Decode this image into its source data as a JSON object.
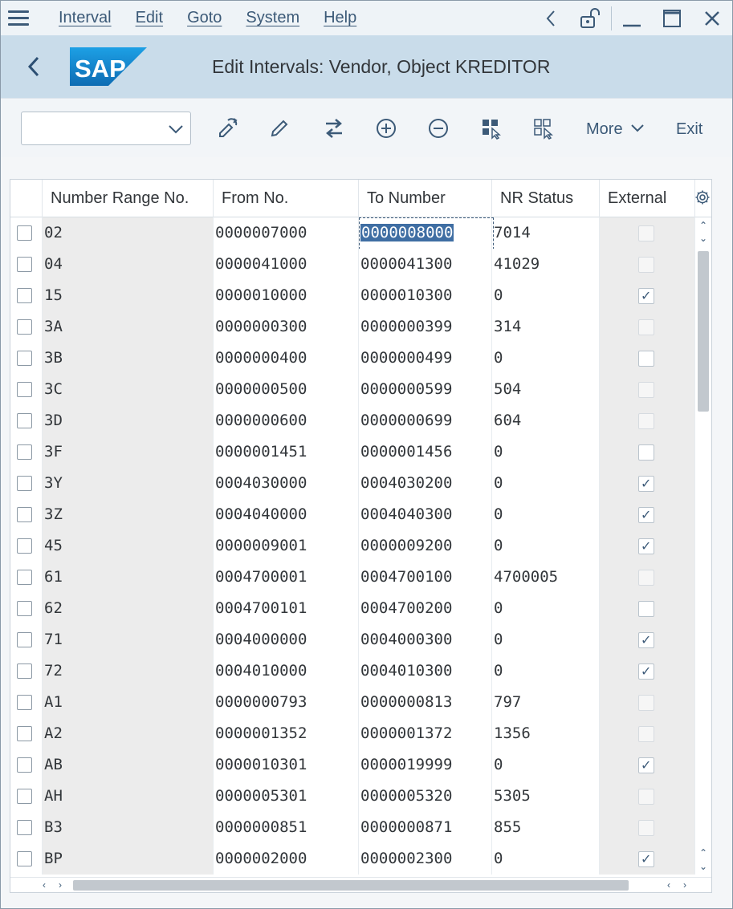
{
  "menu": {
    "items": [
      "Interval",
      "Edit",
      "Goto",
      "System",
      "Help"
    ]
  },
  "header": {
    "logo_text": "SAP",
    "title": "Edit Intervals: Vendor, Object KREDITOR"
  },
  "toolbar": {
    "combo_value": "",
    "more_label": "More",
    "exit_label": "Exit"
  },
  "table": {
    "columns": [
      "Number Range No.",
      "From No.",
      "To Number",
      "NR Status",
      "External"
    ],
    "rows": [
      {
        "nr": "02",
        "from": "0000007000",
        "to": "0000008000",
        "status": "7014",
        "external": false,
        "ext_disabled": true
      },
      {
        "nr": "04",
        "from": "0000041000",
        "to": "0000041300",
        "status": "41029",
        "external": false,
        "ext_disabled": true
      },
      {
        "nr": "15",
        "from": "0000010000",
        "to": "0000010300",
        "status": "0",
        "external": true,
        "ext_disabled": false
      },
      {
        "nr": "3A",
        "from": "0000000300",
        "to": "0000000399",
        "status": "314",
        "external": false,
        "ext_disabled": true
      },
      {
        "nr": "3B",
        "from": "0000000400",
        "to": "0000000499",
        "status": "0",
        "external": false,
        "ext_disabled": false
      },
      {
        "nr": "3C",
        "from": "0000000500",
        "to": "0000000599",
        "status": "504",
        "external": false,
        "ext_disabled": true
      },
      {
        "nr": "3D",
        "from": "0000000600",
        "to": "0000000699",
        "status": "604",
        "external": false,
        "ext_disabled": true
      },
      {
        "nr": "3F",
        "from": "0000001451",
        "to": "0000001456",
        "status": "0",
        "external": false,
        "ext_disabled": false
      },
      {
        "nr": "3Y",
        "from": "0004030000",
        "to": "0004030200",
        "status": "0",
        "external": true,
        "ext_disabled": false
      },
      {
        "nr": "3Z",
        "from": "0004040000",
        "to": "0004040300",
        "status": "0",
        "external": true,
        "ext_disabled": false
      },
      {
        "nr": "45",
        "from": "0000009001",
        "to": "0000009200",
        "status": "0",
        "external": true,
        "ext_disabled": false
      },
      {
        "nr": "61",
        "from": "0004700001",
        "to": "0004700100",
        "status": "4700005",
        "external": false,
        "ext_disabled": true
      },
      {
        "nr": "62",
        "from": "0004700101",
        "to": "0004700200",
        "status": "0",
        "external": false,
        "ext_disabled": false
      },
      {
        "nr": "71",
        "from": "0004000000",
        "to": "0004000300",
        "status": "0",
        "external": true,
        "ext_disabled": false
      },
      {
        "nr": "72",
        "from": "0004010000",
        "to": "0004010300",
        "status": "0",
        "external": true,
        "ext_disabled": false
      },
      {
        "nr": "A1",
        "from": "0000000793",
        "to": "0000000813",
        "status": "797",
        "external": false,
        "ext_disabled": true
      },
      {
        "nr": "A2",
        "from": "0000001352",
        "to": "0000001372",
        "status": "1356",
        "external": false,
        "ext_disabled": true
      },
      {
        "nr": "AB",
        "from": "0000010301",
        "to": "0000019999",
        "status": "0",
        "external": true,
        "ext_disabled": false
      },
      {
        "nr": "AH",
        "from": "0000005301",
        "to": "0000005320",
        "status": "5305",
        "external": false,
        "ext_disabled": true
      },
      {
        "nr": "B3",
        "from": "0000000851",
        "to": "0000000871",
        "status": "855",
        "external": false,
        "ext_disabled": true
      },
      {
        "nr": "BP",
        "from": "0000002000",
        "to": "0000002300",
        "status": "0",
        "external": true,
        "ext_disabled": false
      }
    ]
  },
  "colors": {
    "title_bar": "#c9dcea",
    "accent": "#3c5a78",
    "selection": "#3f6ea3",
    "sap_logo": "#1a7fc1"
  },
  "icons": [
    "menu-icon",
    "collapse-icon",
    "lock-icon",
    "minimize-icon",
    "maximize-icon",
    "close-icon",
    "back-icon",
    "change-icon",
    "edit-icon",
    "transport-icon",
    "add-icon",
    "delete-icon",
    "select-all-icon",
    "deselect-all-icon",
    "chevron-down-icon",
    "settings-icon"
  ]
}
